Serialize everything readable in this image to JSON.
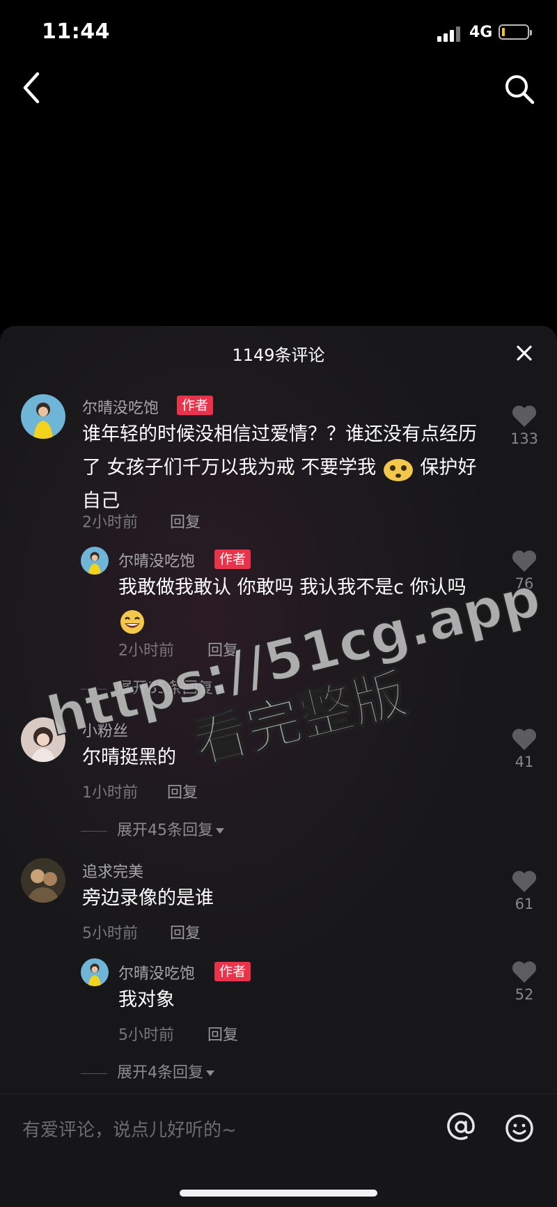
{
  "status_bar": {
    "time": "11:44",
    "network": "4G",
    "battery_level": 0.1
  },
  "panel": {
    "title": "1149条评论"
  },
  "comments": [
    {
      "user": "尔晴没吃饱",
      "badge": "作者",
      "text": "谁年轻的时候没相信过爱情？？谁还没有点经历了 女孩子们千万以我为戒 不要学我",
      "text_tail": "保护好自己",
      "emoji": "shocked-face-emoji",
      "time": "2小时前",
      "reply_label": "回复",
      "likes": "133",
      "replies": [
        {
          "user": "尔晴没吃饱",
          "badge": "作者",
          "text": "我敢做我敢认 你敢吗 我认我不是c 你认吗",
          "emoji": "grinning-face-emoji",
          "time": "2小时前",
          "reply_label": "回复",
          "likes": "76"
        }
      ],
      "expand_label": "展开35条回复"
    },
    {
      "user": "小粉丝",
      "text": "尔晴挺黑的",
      "time": "1小时前",
      "reply_label": "回复",
      "likes": "41",
      "expand_label": "展开45条回复"
    },
    {
      "user": "追求完美",
      "text": "旁边录像的是谁",
      "time": "5小时前",
      "reply_label": "回复",
      "likes": "61",
      "replies": [
        {
          "user": "尔晴没吃饱",
          "badge": "作者",
          "text": "我对象",
          "time": "5小时前",
          "reply_label": "回复",
          "likes": "52"
        }
      ],
      "expand_label": "展开4条回复"
    }
  ],
  "watermark": {
    "url": "https://51cg.app",
    "subtitle": "看完整版"
  },
  "input": {
    "placeholder": "有爱评论，说点儿好听的~"
  },
  "colors": {
    "author_badge": "#e8334a",
    "battery": "#f5c31a",
    "background": "#000000"
  }
}
